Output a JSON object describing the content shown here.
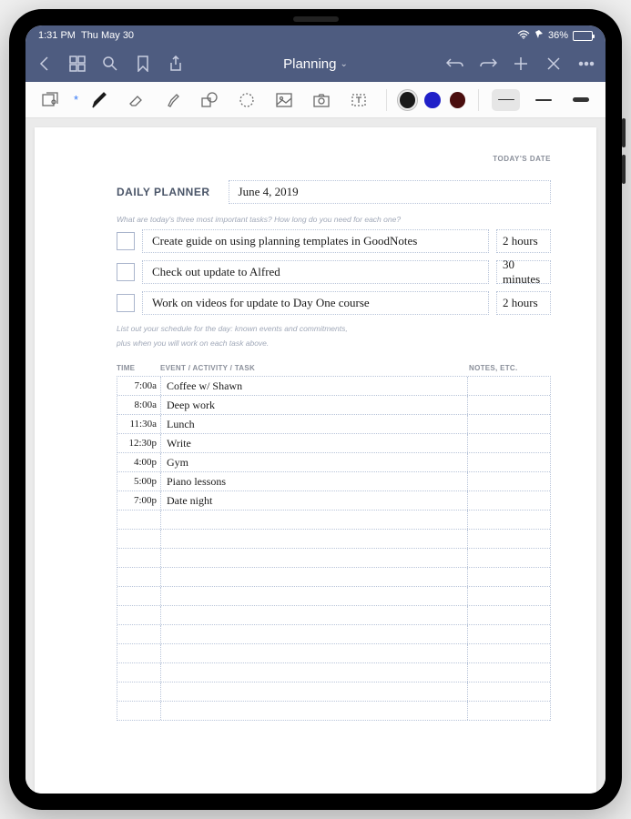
{
  "status": {
    "time": "1:31 PM",
    "date": "Thu May 30",
    "battery_pct": "36%"
  },
  "titlebar": {
    "title": "Planning"
  },
  "page": {
    "todays_date_label": "TODAY'S DATE",
    "planner_title": "DAILY PLANNER",
    "date_value": "June 4, 2019",
    "tasks_hint": "What are today's three most important tasks? How long do you need for each one?",
    "schedule_hint_1": "List out your schedule for the day: known events and commitments,",
    "schedule_hint_2": "plus when you will work on each task above."
  },
  "tasks": [
    {
      "text": "Create guide on using planning templates in GoodNotes",
      "duration": "2 hours"
    },
    {
      "text": "Check out update to Alfred",
      "duration": "30 minutes"
    },
    {
      "text": "Work on videos for update to Day One course",
      "duration": "2 hours"
    }
  ],
  "schedule_headers": {
    "time": "TIME",
    "event": "EVENT / ACTIVITY / TASK",
    "notes": "NOTES, ETC."
  },
  "schedule": [
    {
      "time": "7:00a",
      "event": "Coffee w/ Shawn"
    },
    {
      "time": "8:00a",
      "event": "Deep work"
    },
    {
      "time": "11:30a",
      "event": "Lunch"
    },
    {
      "time": "12:30p",
      "event": "Write"
    },
    {
      "time": "4:00p",
      "event": "Gym"
    },
    {
      "time": "5:00p",
      "event": "Piano lessons"
    },
    {
      "time": "7:00p",
      "event": "Date night"
    },
    {
      "time": "",
      "event": ""
    },
    {
      "time": "",
      "event": ""
    },
    {
      "time": "",
      "event": ""
    },
    {
      "time": "",
      "event": ""
    },
    {
      "time": "",
      "event": ""
    },
    {
      "time": "",
      "event": ""
    },
    {
      "time": "",
      "event": ""
    },
    {
      "time": "",
      "event": ""
    },
    {
      "time": "",
      "event": ""
    },
    {
      "time": "",
      "event": ""
    },
    {
      "time": "",
      "event": ""
    }
  ],
  "colors": {
    "black": "#1a1a1a",
    "blue": "#2020c8",
    "red": "#4a0e0e"
  }
}
